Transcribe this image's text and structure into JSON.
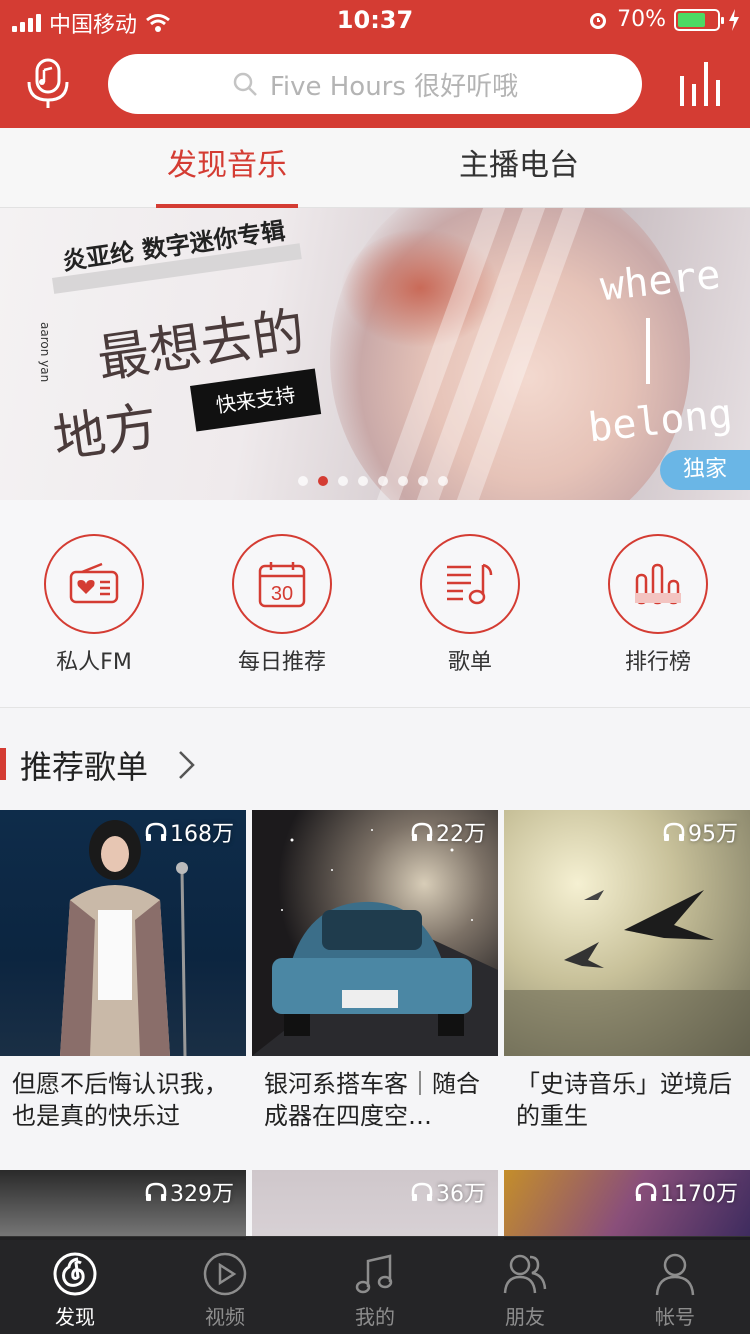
{
  "status": {
    "carrier": "中国移动",
    "time": "10:37",
    "battery": "70%"
  },
  "search": {
    "placeholder": "Five Hours 很好听哦"
  },
  "tabs": [
    {
      "label": "发现音乐"
    },
    {
      "label": "主播电台"
    }
  ],
  "banner": {
    "artist_line": "炎亚纶 数字迷你专辑",
    "title_line1": "最想去的",
    "title_line2": "地方",
    "side_text": "aaron yan",
    "cta": "快来支持",
    "english_top": "where",
    "english_bottom": "belong",
    "badge": "独家",
    "active_dot": 1,
    "dot_count": 8
  },
  "quick": [
    {
      "label": "私人FM",
      "icon": "radio-icon"
    },
    {
      "label": "每日推荐",
      "icon": "calendar-icon",
      "day": "30"
    },
    {
      "label": "歌单",
      "icon": "playlist-icon"
    },
    {
      "label": "排行榜",
      "icon": "chart-icon"
    }
  ],
  "section": {
    "title": "推荐歌单"
  },
  "playlists": [
    {
      "count": "168万",
      "name": "但愿不后悔认识我，也是真的快乐过"
    },
    {
      "count": "22万",
      "name": "银河系搭车客｜随合成器在四度空…"
    },
    {
      "count": "95万",
      "name": "「史诗音乐」逆境后的重生"
    },
    {
      "count": "329万",
      "name": ""
    },
    {
      "count": "36万",
      "name": ""
    },
    {
      "count": "1170万",
      "name": ""
    }
  ],
  "tabbar": [
    {
      "label": "发现",
      "icon": "netease-logo-icon"
    },
    {
      "label": "视频",
      "icon": "video-icon"
    },
    {
      "label": "我的",
      "icon": "music-note-icon"
    },
    {
      "label": "朋友",
      "icon": "friends-icon"
    },
    {
      "label": "帐号",
      "icon": "account-icon"
    }
  ],
  "colors": {
    "accent": "#d43c33",
    "badge": "#6ab6e6"
  }
}
